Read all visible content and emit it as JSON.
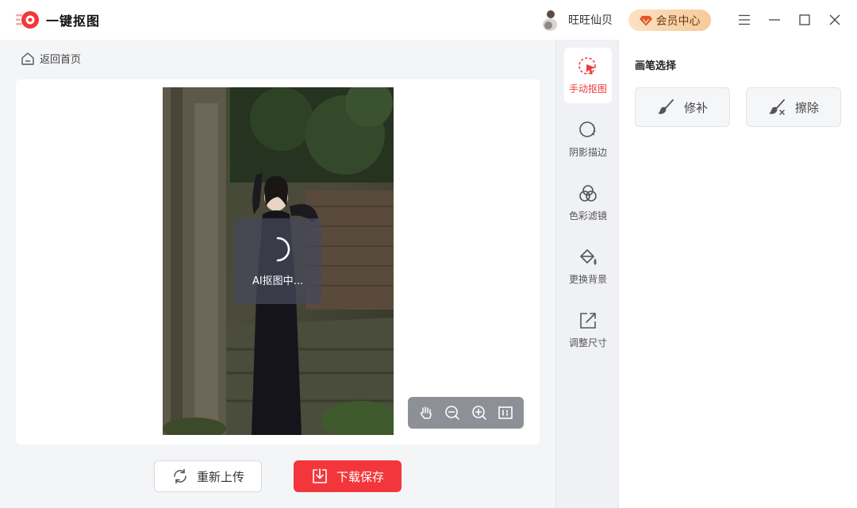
{
  "app": {
    "name": "一键抠图",
    "brand_color": "#f2363b"
  },
  "header": {
    "user_name": "旺旺仙贝",
    "vip_label": "会员中心",
    "window_controls": [
      "menu-icon",
      "minimize-icon",
      "maximize-icon",
      "close-icon"
    ]
  },
  "main": {
    "back_label": "返回首页",
    "loading_text": "AI抠图中...",
    "zoom_tools": [
      "hand-icon",
      "zoom-out-icon",
      "zoom-in-icon",
      "fit-screen-icon"
    ],
    "reupload_label": "重新上传",
    "download_label": "下载保存"
  },
  "tools": [
    {
      "label": "手动抠图",
      "icon": "manual-cutout-icon",
      "active": true
    },
    {
      "label": "阴影描边",
      "icon": "shadow-outline-icon",
      "active": false
    },
    {
      "label": "色彩滤镜",
      "icon": "color-filter-icon",
      "active": false
    },
    {
      "label": "更换背景",
      "icon": "paint-bucket-icon",
      "active": false
    },
    {
      "label": "调整尺寸",
      "icon": "resize-icon",
      "active": false
    }
  ],
  "panel": {
    "title": "画笔选择",
    "repair_label": "修补",
    "erase_label": "擦除"
  }
}
